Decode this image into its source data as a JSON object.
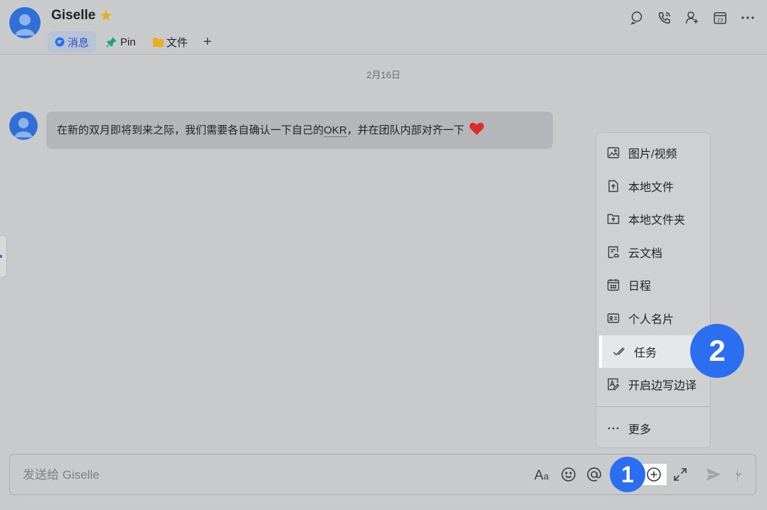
{
  "chat": {
    "name": "Giselle",
    "tabs": [
      {
        "label": "消息",
        "icon": "chat-bubble-icon"
      },
      {
        "label": "Pin",
        "icon": "pin-icon"
      },
      {
        "label": "文件",
        "icon": "folder-icon"
      }
    ],
    "add_tab_label": "+"
  },
  "header_actions": [
    "search-chat-icon",
    "call-icon",
    "add-member-icon",
    "calendar-icon",
    "more-icon"
  ],
  "calendar_day": "23",
  "messages": {
    "date": "2月16日",
    "items": [
      {
        "sender": "Giselle",
        "text_before": "在新的双月即将到来之际，我们需要各自确认一下自己的",
        "link": "OKR",
        "text_after": "，并在团队内部对齐一下"
      }
    ]
  },
  "menu": {
    "items": [
      {
        "label": "图片/视频",
        "icon": "image-icon"
      },
      {
        "label": "本地文件",
        "icon": "upload-file-icon"
      },
      {
        "label": "本地文件夹",
        "icon": "upload-folder-icon"
      },
      {
        "label": "云文档",
        "icon": "cloud-doc-icon"
      },
      {
        "label": "日程",
        "icon": "calendar-icon"
      },
      {
        "label": "个人名片",
        "icon": "contact-card-icon"
      },
      {
        "label": "任务",
        "icon": "task-icon"
      },
      {
        "label": "开启边写边译",
        "icon": "translate-icon"
      }
    ],
    "more_label": "更多"
  },
  "input": {
    "placeholder": "发送给 Giselle",
    "value": ""
  },
  "steps": {
    "one": "1",
    "two": "2"
  },
  "colors": {
    "accent": "#2c6ef0",
    "star": "#e8b020",
    "pin": "#18a877",
    "folder": "#e8b020",
    "heart": "#e02b2b"
  }
}
